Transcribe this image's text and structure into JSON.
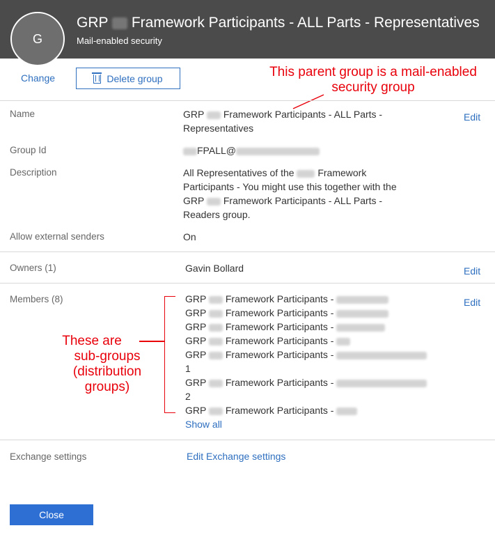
{
  "header": {
    "avatar_letter": "G",
    "title_prefix": "GRP",
    "title_suffix": "Framework Participants - ALL Parts - Representatives",
    "subtitle": "Mail-enabled security"
  },
  "toolbar": {
    "change_label": "Change",
    "delete_label": "Delete group"
  },
  "annotations": {
    "top": [
      "This parent group is a mail-enabled",
      "security group"
    ],
    "side": [
      "These are",
      "sub-groups",
      "(distribution",
      "groups)"
    ]
  },
  "fields": {
    "name_label": "Name",
    "name_line1_prefix": "GRP",
    "name_line1_suffix": "Framework Participants - ALL Parts -",
    "name_line2": "Representatives",
    "group_id_label": "Group Id",
    "group_id_value": "FPALL@",
    "description_label": "Description",
    "description_line1_prefix": "All Representatives of the",
    "description_line1_suffix": "Framework",
    "description_line2": "Participants - You might use this together with the",
    "description_line3_prefix": "GRP",
    "description_line3_suffix": "Framework Participants - ALL Parts -",
    "description_line4": "Readers group.",
    "external_label": "Allow external senders",
    "external_value": "On",
    "owners_label": "Owners (1)",
    "owners_value": "Gavin Bollard",
    "members_label": "Members (8)",
    "exchange_label": "Exchange settings",
    "exchange_link": "Edit Exchange settings",
    "edit_label": "Edit"
  },
  "members": {
    "prefix": "GRP",
    "suffix": "Framework Participants -",
    "wrap_1": "1",
    "wrap_2": "2",
    "show_all": "Show all"
  },
  "footer": {
    "close_label": "Close"
  }
}
